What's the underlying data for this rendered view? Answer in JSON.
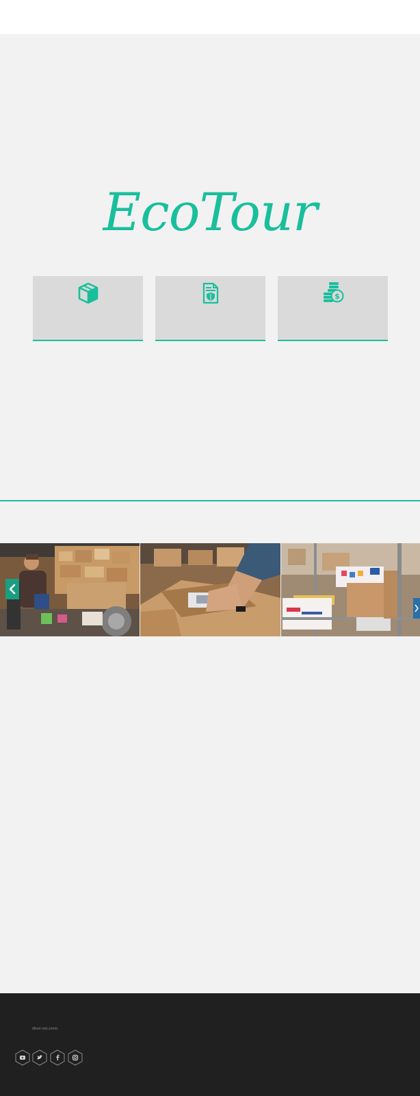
{
  "brand": {
    "logo_text": "EcoTour",
    "accent_color": "#19bf9c"
  },
  "features": [
    {
      "icon": "package-box-icon"
    },
    {
      "icon": "shield-document-icon"
    },
    {
      "icon": "coins-dollar-icon"
    }
  ],
  "gallery": {
    "slides": [
      {
        "image": "warehouse-worker-taping-boxes"
      },
      {
        "image": "hands-packing-open-box"
      },
      {
        "image": "shelf-of-shipping-boxes"
      }
    ],
    "prev_icon": "chevron-left-icon",
    "next_icon": "chevron-right-icon"
  },
  "footer": {
    "text": "dhost cmz.zomrc",
    "background": "#202020",
    "social": [
      {
        "icon": "youtube-icon"
      },
      {
        "icon": "twitter-icon"
      },
      {
        "icon": "facebook-icon"
      },
      {
        "icon": "instagram-icon"
      }
    ]
  }
}
